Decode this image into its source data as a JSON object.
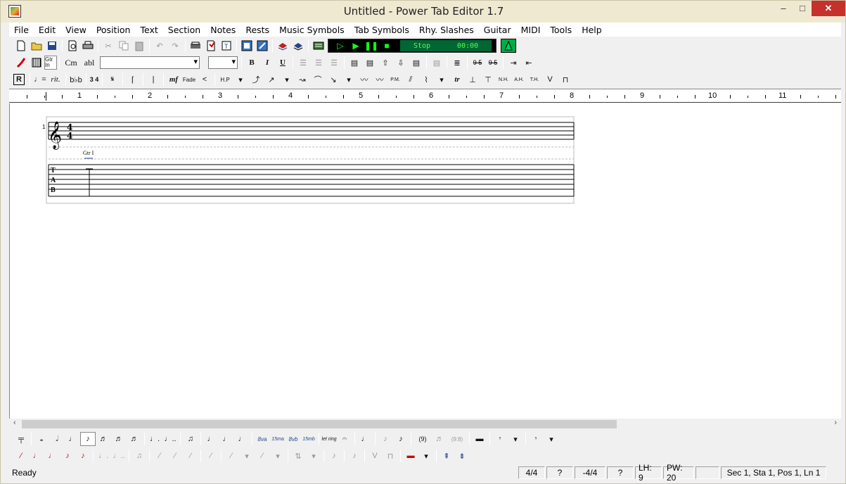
{
  "window": {
    "title": "Untitled - Power Tab Editor 1.7",
    "min": "–",
    "max": "□",
    "close": "✕"
  },
  "menu": [
    "File",
    "Edit",
    "View",
    "Position",
    "Text",
    "Section",
    "Notes",
    "Rests",
    "Music Symbols",
    "Tab Symbols",
    "Rhy. Slashes",
    "Guitar",
    "MIDI",
    "Tools",
    "Help"
  ],
  "toolbar": {
    "chord_btn": "Cm",
    "text_btn": "abl",
    "guitar_btn": "Gtr In",
    "bold": "B",
    "italic": "I",
    "underline": "U",
    "stop_label": "Stop",
    "time": "00:00",
    "rehearsal": "R",
    "rit": "rit.",
    "key": "b♭b",
    "time_sig": "3 4",
    "dynamic": "mf",
    "fade": "Fade",
    "hp": "H.P",
    "pm": "P.M.",
    "tr": "tr",
    "nh": "N.H.",
    "ah": "A.H.",
    "th": "T.H.",
    "v": "V",
    "num95a": "9 5",
    "num95b": "9 5"
  },
  "ruler": {
    "numbers": [
      "1",
      "2",
      "3",
      "4",
      "5",
      "6",
      "7",
      "8",
      "9",
      "10",
      "11"
    ]
  },
  "score": {
    "system_number": "1",
    "time_top": "4",
    "time_bottom": "4",
    "guitar_label": "Gtr I",
    "tab_letters": [
      "T",
      "A",
      "B"
    ]
  },
  "bottom_toolbar": {
    "tuplet": "(9)",
    "tuplet2": "(9:8)",
    "ottava": "8va",
    "quindi": "15ma",
    "ottavab": "8vb",
    "quindib": "15mb",
    "letring": "let ring"
  },
  "status": {
    "ready": "Ready",
    "time_sig": "4/4",
    "q1": "?",
    "neg_sig": "-4/4",
    "q2": "?",
    "lh": "LH: 9",
    "pw": "PW: 20",
    "position": "Sec 1, Sta 1, Pos 1, Ln 1"
  }
}
